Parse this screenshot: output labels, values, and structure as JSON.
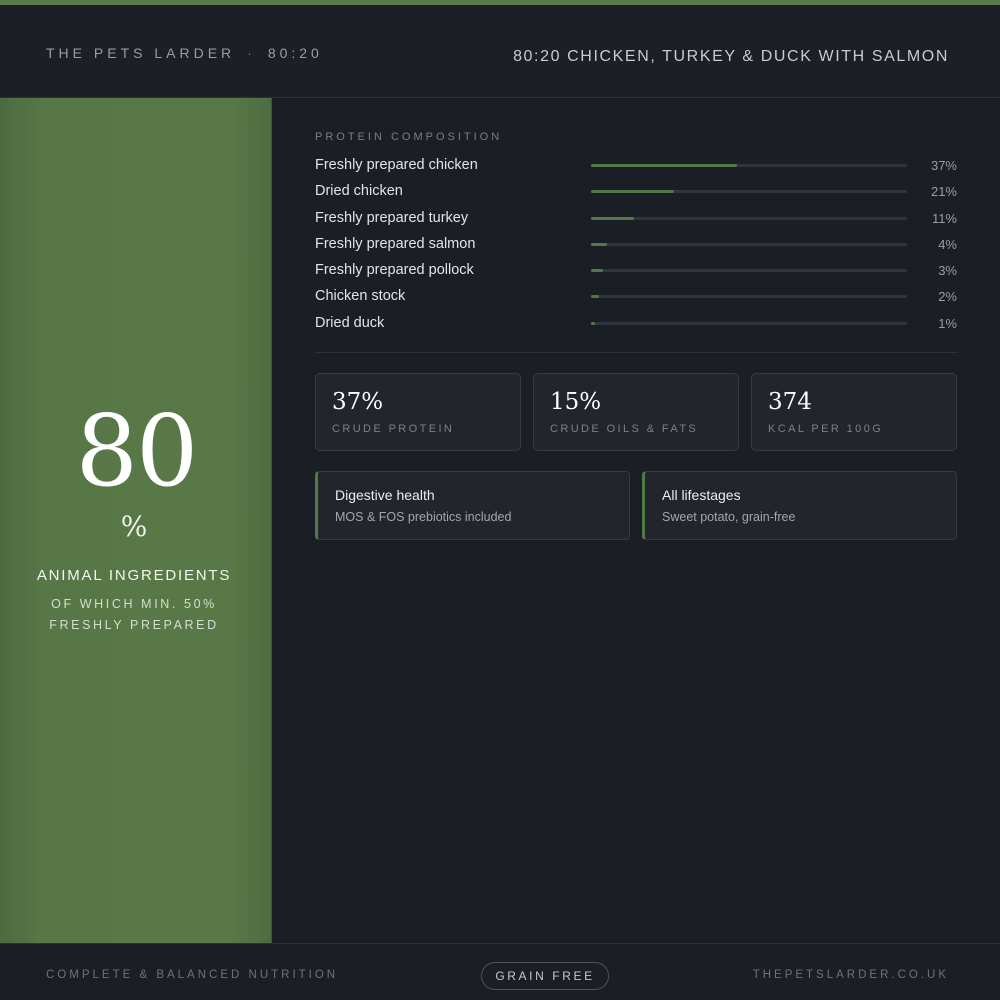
{
  "header": {
    "brand": "THE PETS LARDER",
    "separator": "·",
    "ratio": "80:20",
    "product_title": "80:20 CHICKEN, TURKEY & DUCK WITH SALMON"
  },
  "hero": {
    "number": "80",
    "percent_sign": "%",
    "label": "ANIMAL INGREDIENTS",
    "sub_line_1": "OF WHICH MIN. 50%",
    "sub_line_2": "FRESHLY PREPARED"
  },
  "composition": {
    "section_label": "PROTEIN COMPOSITION",
    "rows": [
      {
        "name": "Freshly prepared chicken",
        "percent_label": "37%",
        "percent": 37
      },
      {
        "name": "Dried chicken",
        "percent_label": "21%",
        "percent": 21
      },
      {
        "name": "Freshly prepared turkey",
        "percent_label": "11%",
        "percent": 11
      },
      {
        "name": "Freshly prepared salmon",
        "percent_label": "4%",
        "percent": 4
      },
      {
        "name": "Freshly prepared pollock",
        "percent_label": "3%",
        "percent": 3
      },
      {
        "name": "Chicken stock",
        "percent_label": "2%",
        "percent": 2
      },
      {
        "name": "Dried duck",
        "percent_label": "1%",
        "percent": 1
      }
    ]
  },
  "stats": [
    {
      "value": "37%",
      "label": "CRUDE PROTEIN"
    },
    {
      "value": "15%",
      "label": "CRUDE OILS & FATS"
    },
    {
      "value": "374",
      "label": "KCAL PER 100G"
    }
  ],
  "features": [
    {
      "title": "Digestive health",
      "subtitle": "MOS & FOS prebiotics included"
    },
    {
      "title": "All lifestages",
      "subtitle": "Sweet potato, grain-free"
    }
  ],
  "footer": {
    "left": "COMPLETE & BALANCED NUTRITION",
    "badge": "GRAIN FREE",
    "right": "THEPETSLARDER.CO.UK"
  },
  "colors": {
    "accent_green": "#587847",
    "bar_fill": "#4f7a45",
    "background": "#1b1e24"
  }
}
